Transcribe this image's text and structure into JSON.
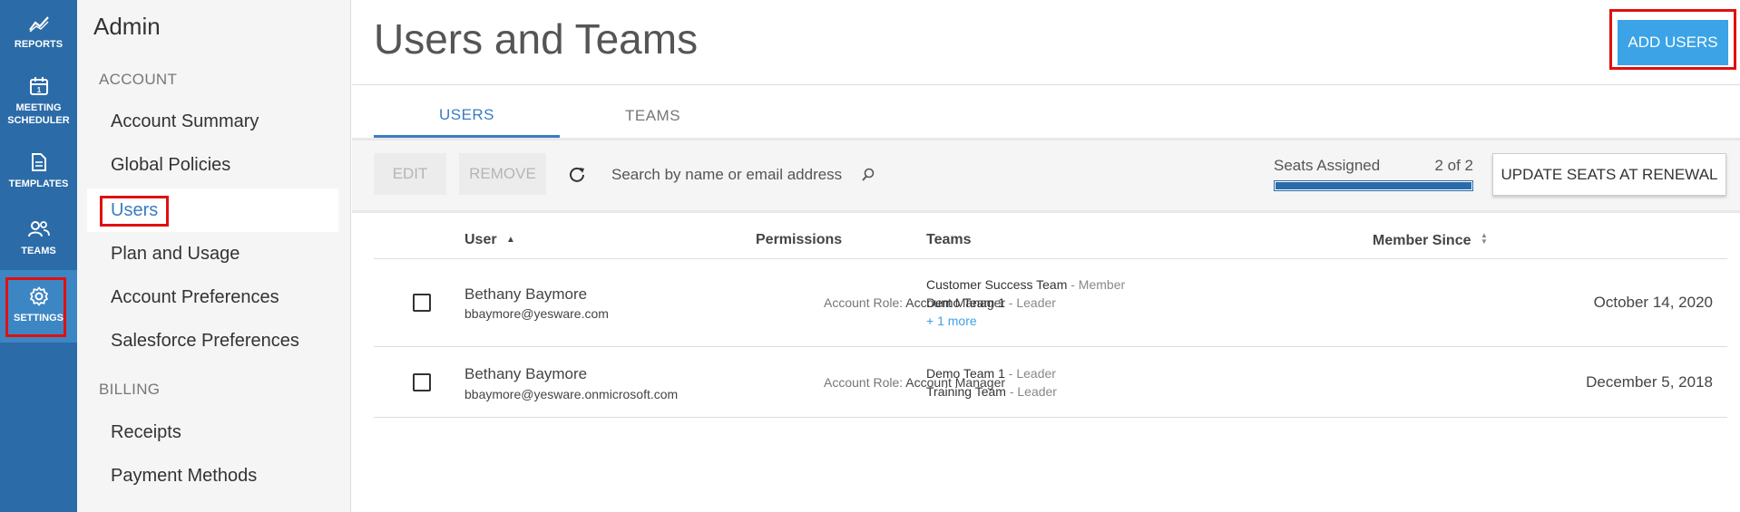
{
  "rail": {
    "items": [
      {
        "label": "REPORTS",
        "icon": "chart-line-icon"
      },
      {
        "label": "MEETING SCHEDULER",
        "icon": "calendar-icon"
      },
      {
        "label": "TEMPLATES",
        "icon": "document-icon"
      },
      {
        "label": "TEAMS",
        "icon": "people-icon"
      },
      {
        "label": "SETTINGS",
        "icon": "gear-icon"
      }
    ],
    "active": "SETTINGS"
  },
  "admin": {
    "title": "Admin",
    "sections": [
      {
        "heading": "ACCOUNT",
        "items": [
          "Account Summary",
          "Global Policies",
          "Users",
          "Plan and Usage",
          "Account Preferences",
          "Salesforce Preferences"
        ]
      },
      {
        "heading": "BILLING",
        "items": [
          "Receipts",
          "Payment Methods"
        ]
      }
    ],
    "active_item": "Users"
  },
  "header": {
    "title": "Users and Teams",
    "add_users_label": "ADD USERS"
  },
  "tabs": [
    {
      "label": "USERS",
      "active": true
    },
    {
      "label": "TEAMS",
      "active": false
    }
  ],
  "toolbar": {
    "edit_label": "EDIT",
    "remove_label": "REMOVE",
    "search_placeholder": "Search by name or email address",
    "seats_label": "Seats Assigned",
    "seats_count": "2 of 2",
    "seats_fraction": 1.0,
    "update_seats_label": "UPDATE SEATS AT RENEWAL"
  },
  "table": {
    "columns": [
      "User",
      "Permissions",
      "Teams",
      "Member Since"
    ],
    "rows": [
      {
        "name": "Bethany Baymore",
        "email": "bbaymore@yesware.com",
        "role_label": "Account Role:",
        "role": "Account Manager",
        "teams": [
          {
            "name": "Customer Success Team",
            "role": " - Member"
          },
          {
            "name": "Demo Team 1",
            "role": " - Leader"
          }
        ],
        "more": "+ 1 more",
        "since": "October 14, 2020"
      },
      {
        "name": "Bethany Baymore",
        "email": "bbaymore@yesware.onmicrosoft.com",
        "role_label": "Account Role:",
        "role": "Account Manager",
        "teams": [
          {
            "name": "Demo Team 1",
            "role": " - Leader"
          },
          {
            "name": "Training Team",
            "role": " - Leader"
          }
        ],
        "since": "December 5, 2018"
      }
    ]
  },
  "colors": {
    "rail_bg": "#2b6ba8",
    "accent": "#3ba3e6",
    "highlight": "#e01010"
  }
}
